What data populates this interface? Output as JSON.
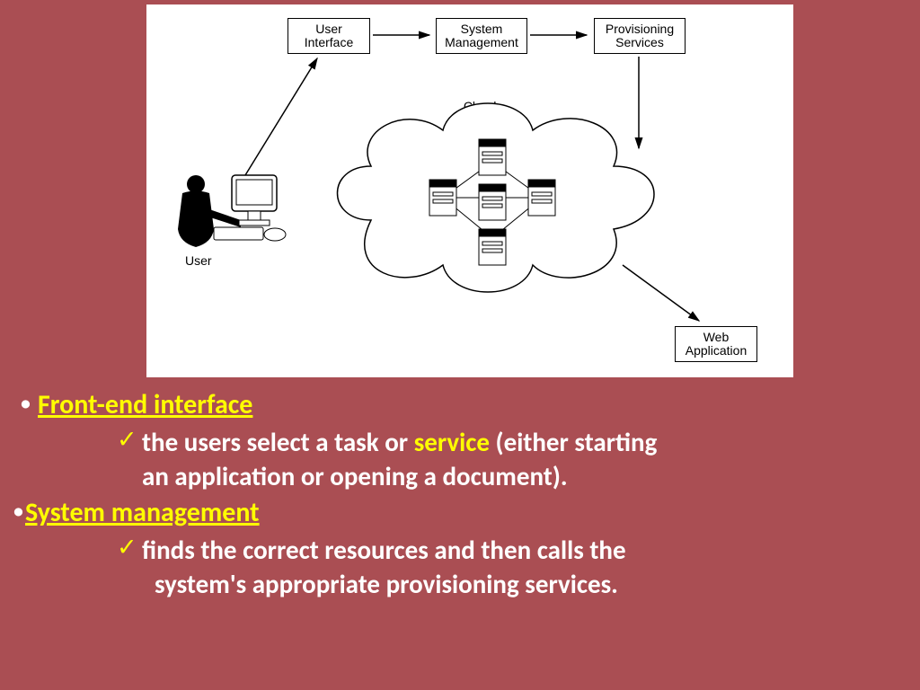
{
  "diagram": {
    "user_label": "User",
    "box_ui": "User\nInterface",
    "box_sys": "System\nManagement",
    "box_prov": "Provisioning\nServices",
    "box_web": "Web\nApplication",
    "cloud_label": "Cloud\nServers"
  },
  "content": {
    "h1": "Front-end interface",
    "p1a": "the users select a task or ",
    "p1b": "service",
    "p1c": " (either starting",
    "p1d": "an application or opening a document).",
    "h2": "System  management",
    "p2a": "finds the correct resources and then calls the",
    "p2b": "system's appropriate provisioning services."
  }
}
